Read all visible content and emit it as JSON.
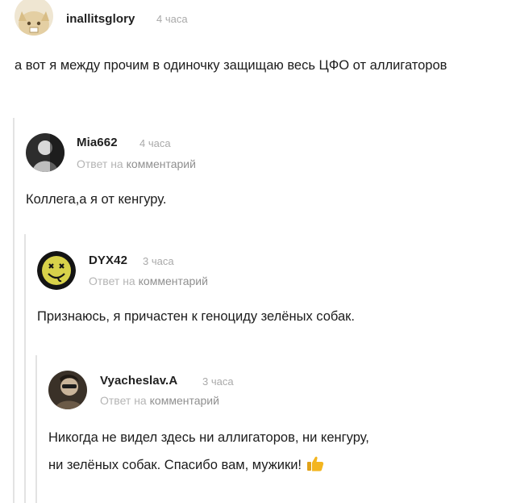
{
  "comments": [
    {
      "username": "inallitsglory",
      "time": "4 часа",
      "avatar_icon": "cat-face-avatar",
      "text": "а вот я между прочим в одиночку защищаю весь ЦФО от аллигаторов"
    },
    {
      "username": "Mia662",
      "time": "4 часа",
      "avatar_icon": "dark-portrait-avatar",
      "reply_prefix": "Ответ на",
      "reply_target": "комментарий",
      "text": "Коллега,а я от кенгуру."
    },
    {
      "username": "DYX42",
      "time": "3 часа",
      "avatar_icon": "smiley-face-avatar",
      "reply_prefix": "Ответ на",
      "reply_target": "комментарий",
      "text": "Признаюсь, я причастен к геноциду зелёных собак."
    },
    {
      "username": "Vyacheslav.A",
      "time": "3 часа",
      "avatar_icon": "photo-portrait-avatar",
      "reply_prefix": "Ответ на",
      "reply_target": "комментарий",
      "text_line1": "Никогда не видел здесь ни аллигаторов, ни кенгуру,",
      "text_line2": "ни зелёных собак. Спасибо вам, мужики!",
      "emoji": "thumbs-up-icon"
    }
  ],
  "colors": {
    "text": "#1c1c1c",
    "meta": "#a9a9a9",
    "rail": "#e3e3e3",
    "thumb": "#f3b51f"
  }
}
